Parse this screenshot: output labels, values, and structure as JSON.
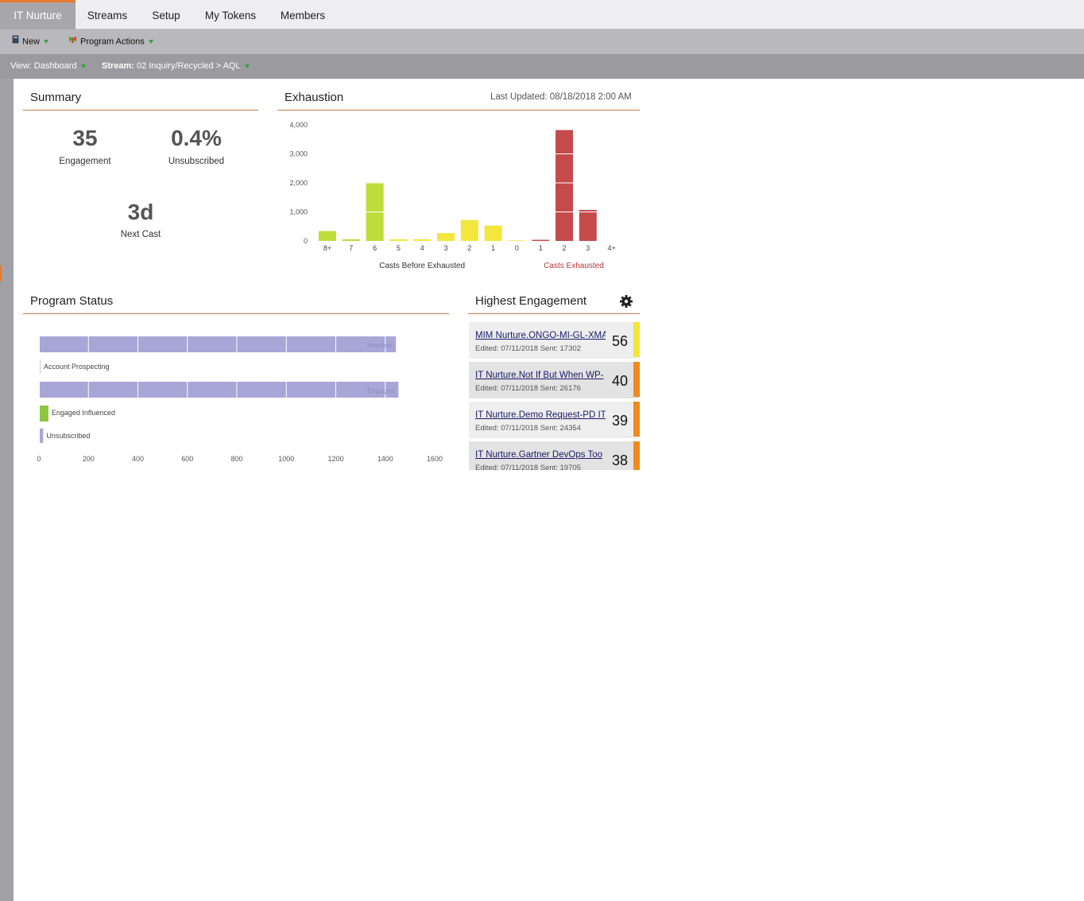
{
  "tabs": [
    "IT Nurture",
    "Streams",
    "Setup",
    "My Tokens",
    "Members"
  ],
  "toolbar": {
    "new_label": "New",
    "actions_label": "Program Actions"
  },
  "viewbar": {
    "view_prefix": "View:",
    "view_value": "Dashboard",
    "stream_prefix": "Stream:",
    "stream_value": "02 Inquiry/Recycled > AQL"
  },
  "summary": {
    "title": "Summary",
    "engagement_value": "35",
    "engagement_label": "Engagement",
    "unsub_value": "0.4%",
    "unsub_label": "Unsubscribed",
    "nextcast_value": "3d",
    "nextcast_label": "Next Cast"
  },
  "exhaustion": {
    "title": "Exhaustion",
    "last_updated": "Last Updated: 08/18/2018 2:00 AM",
    "chart_data": {
      "type": "bar",
      "categories": [
        "8+",
        "7",
        "6",
        "5",
        "4",
        "3",
        "2",
        "1",
        "0",
        "1",
        "2",
        "3",
        "4+"
      ],
      "values": [
        340,
        60,
        2020,
        60,
        60,
        270,
        720,
        530,
        20,
        40,
        3820,
        1070,
        0
      ],
      "groups": [
        "before",
        "before",
        "before",
        "before",
        "before",
        "before",
        "before",
        "before",
        "before",
        "after",
        "after",
        "after",
        "after"
      ],
      "colors": [
        "#bfdd3a",
        "#bfdd3a",
        "#bfdd3a",
        "#f3e63c",
        "#f3e63c",
        "#f3e63c",
        "#f3e63c",
        "#f3e63c",
        "#f3e63c",
        "#c54a4a",
        "#c54a4a",
        "#c54a4a",
        "#c54a4a"
      ],
      "yticks": [
        "0",
        "1,000",
        "2,000",
        "3,000",
        "4,000"
      ],
      "ylim": [
        0,
        4000
      ],
      "xlabel_left": "Casts Before Exhausted",
      "xlabel_right": "Casts Exhausted"
    }
  },
  "program_status": {
    "title": "Program Status",
    "chart_data": {
      "type": "bar",
      "orientation": "horizontal",
      "rows": [
        {
          "label": "Member",
          "value": 1440,
          "color": "#a8a6d6",
          "label_inside": true
        },
        {
          "label": "Account Prospecting",
          "value": 0,
          "color": "#a8a6d6",
          "label_inside": false
        },
        {
          "label": "Engaged",
          "value": 1450,
          "color": "#a8a6d6",
          "label_inside": true
        },
        {
          "label": "Engaged Influenced",
          "value": 35,
          "color": "#8dc63f",
          "label_inside": false
        },
        {
          "label": "Unsubscribed",
          "value": 14,
          "color": "#a8a6d6",
          "label_inside": false
        }
      ],
      "xticks": [
        "0",
        "200",
        "400",
        "600",
        "800",
        "1000",
        "1200",
        "1400",
        "1600"
      ],
      "xlim": [
        0,
        1600
      ]
    }
  },
  "highest_engagement": {
    "title": "Highest Engagement",
    "items": [
      {
        "name": "MIM Nurture.ONGO-MI-GL-XMAS",
        "meta": "Edited: 07/11/2018   Sent: 17302",
        "score": "56",
        "color": "#f3e63c"
      },
      {
        "name": "IT Nurture.Not If But When WP-",
        "meta": "Edited: 07/11/2018   Sent: 26176",
        "score": "40",
        "color": "#f08a1c"
      },
      {
        "name": "IT Nurture.Demo Request-PD IT",
        "meta": "Edited: 07/11/2018   Sent: 24354",
        "score": "39",
        "color": "#f08a1c"
      },
      {
        "name": "IT Nurture.Gartner DevOps Too",
        "meta": "Edited: 07/11/2018   Sent: 19705",
        "score": "38",
        "color": "#f08a1c"
      }
    ]
  }
}
